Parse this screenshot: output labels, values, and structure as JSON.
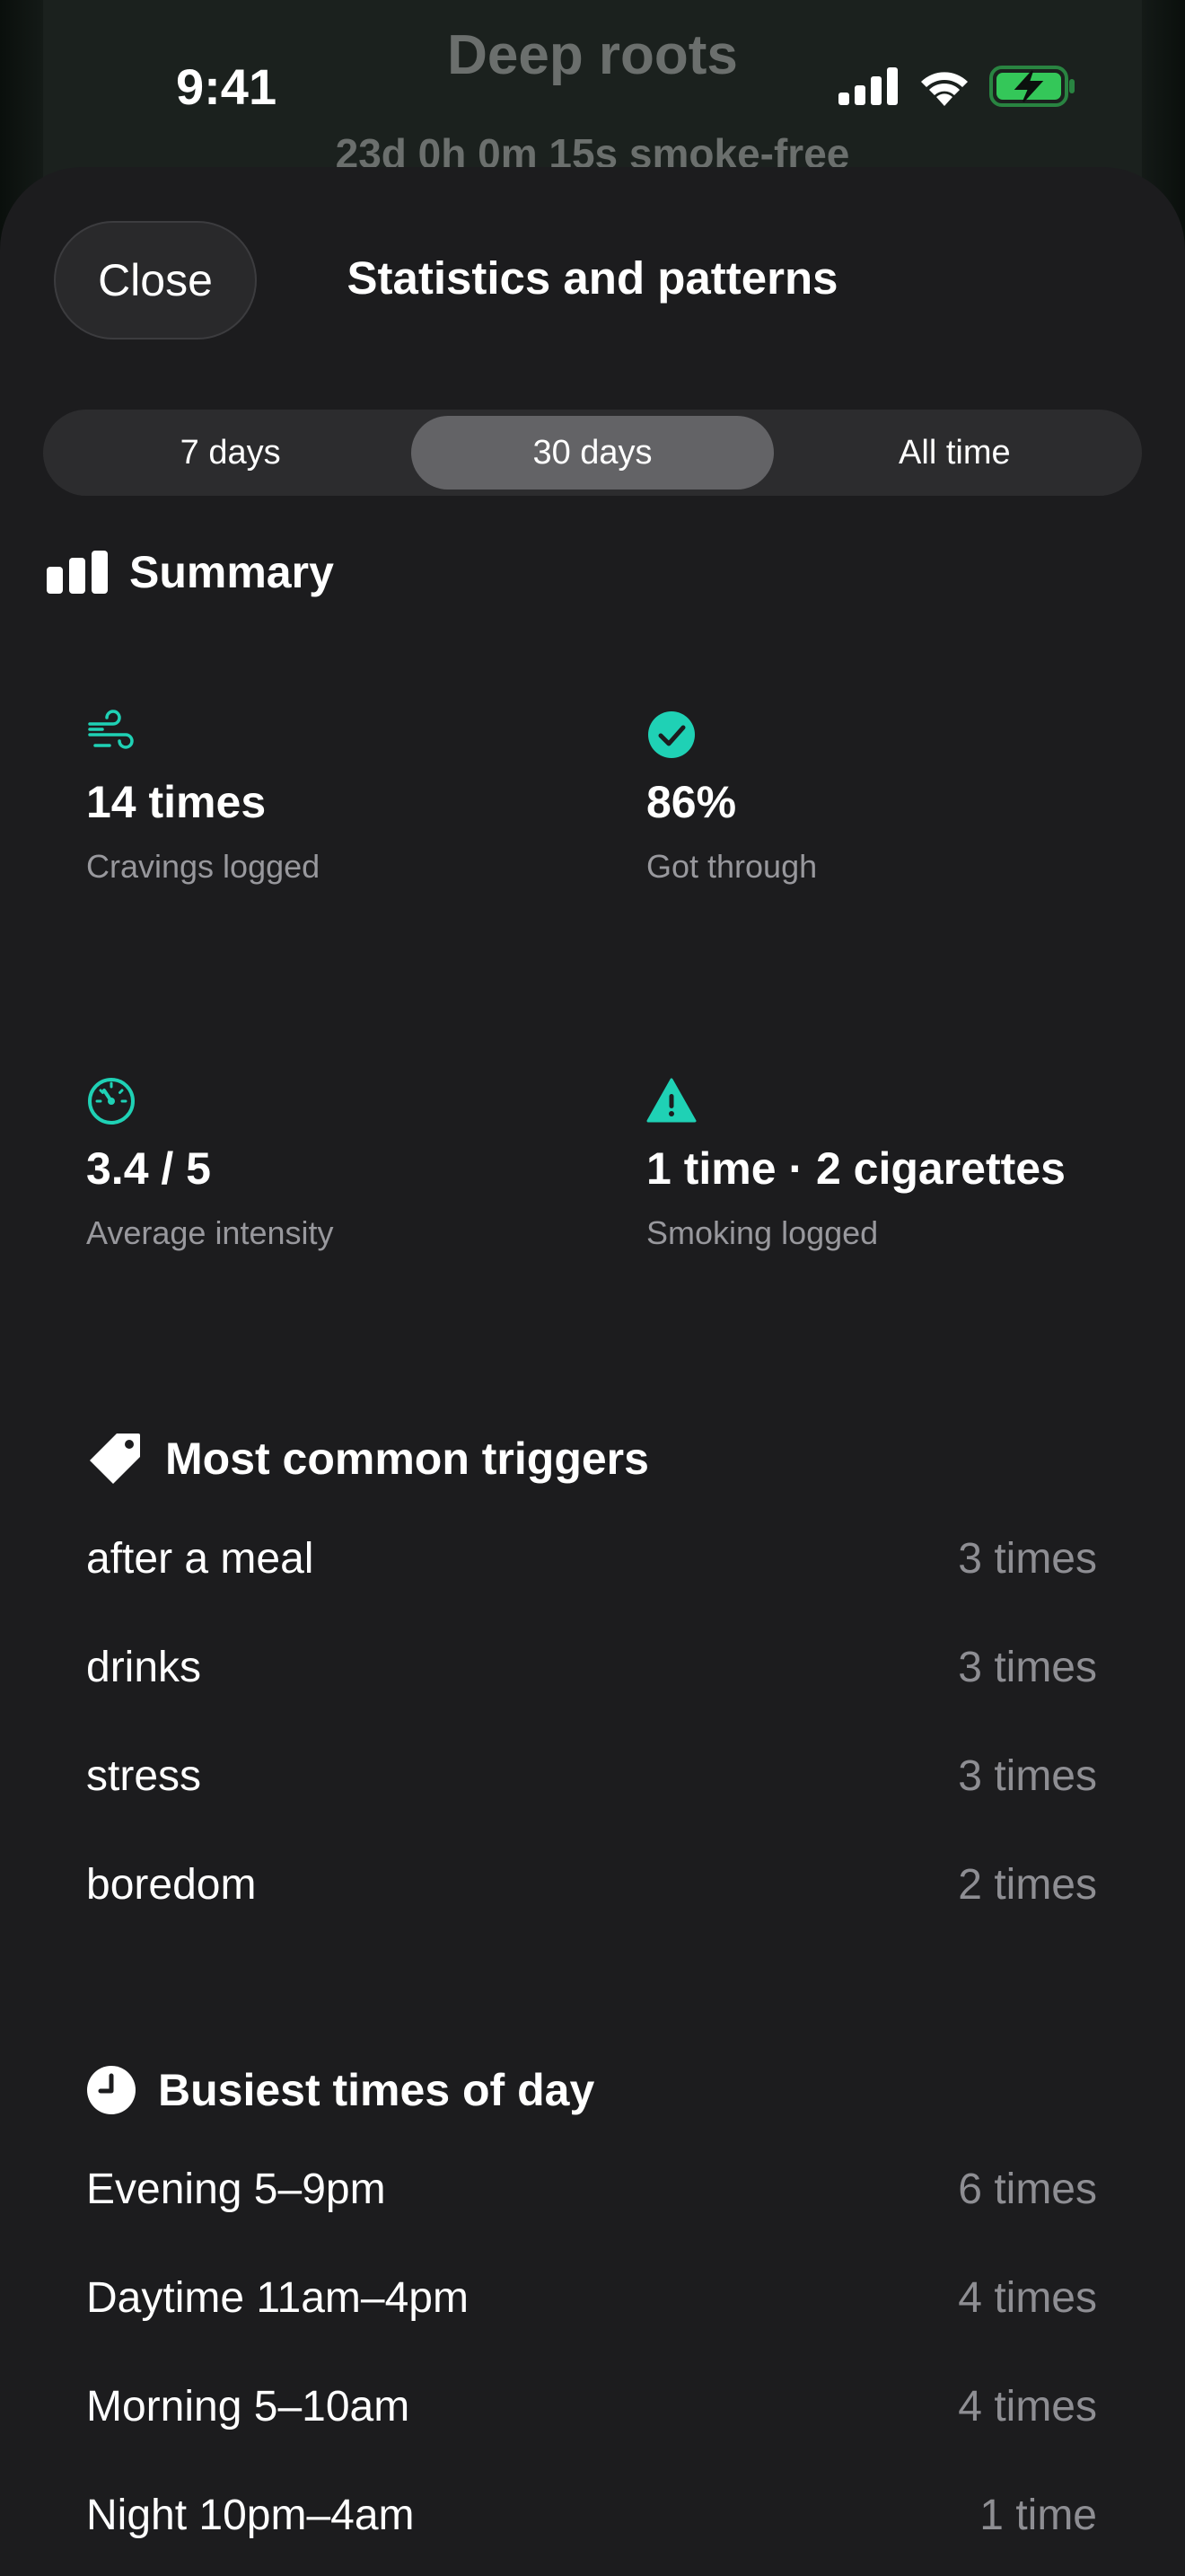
{
  "background_app": {
    "title": "Deep roots",
    "subtitle": "23d 0h 0m 15s smoke-free"
  },
  "status_bar": {
    "time": "9:41",
    "icons": [
      "cellular-signal-icon",
      "wifi-icon",
      "battery-charging-icon"
    ],
    "battery_color": "#34c759"
  },
  "sheet": {
    "close_label": "Close",
    "title": "Statistics and patterns"
  },
  "range_tabs": {
    "items": [
      "7 days",
      "30 days",
      "All time"
    ],
    "selected": "30 days"
  },
  "summary": {
    "heading": "Summary",
    "accent_color": "#1fd1b5",
    "stats": [
      {
        "icon": "wind-icon",
        "value": "14 times",
        "label": "Cravings logged"
      },
      {
        "icon": "checkmark-circle-icon",
        "value": "86%",
        "label": "Got through"
      },
      {
        "icon": "gauge-icon",
        "value": "3.4 / 5",
        "label": "Average intensity"
      },
      {
        "icon": "warning-triangle-icon",
        "value": "1 time · 2 cigarettes",
        "label": "Smoking logged"
      }
    ]
  },
  "triggers": {
    "heading": "Most common triggers",
    "items": [
      {
        "name": "after a meal",
        "count": "3 times"
      },
      {
        "name": "drinks",
        "count": "3 times"
      },
      {
        "name": "stress",
        "count": "3 times"
      },
      {
        "name": "boredom",
        "count": "2 times"
      }
    ]
  },
  "times_of_day": {
    "heading": "Busiest times of day",
    "items": [
      {
        "name": "Evening 5–9pm",
        "count": "6 times"
      },
      {
        "name": "Daytime 11am–4pm",
        "count": "4 times"
      },
      {
        "name": "Morning 5–10am",
        "count": "4 times"
      },
      {
        "name": "Night 10pm–4am",
        "count": "1 time"
      }
    ]
  }
}
